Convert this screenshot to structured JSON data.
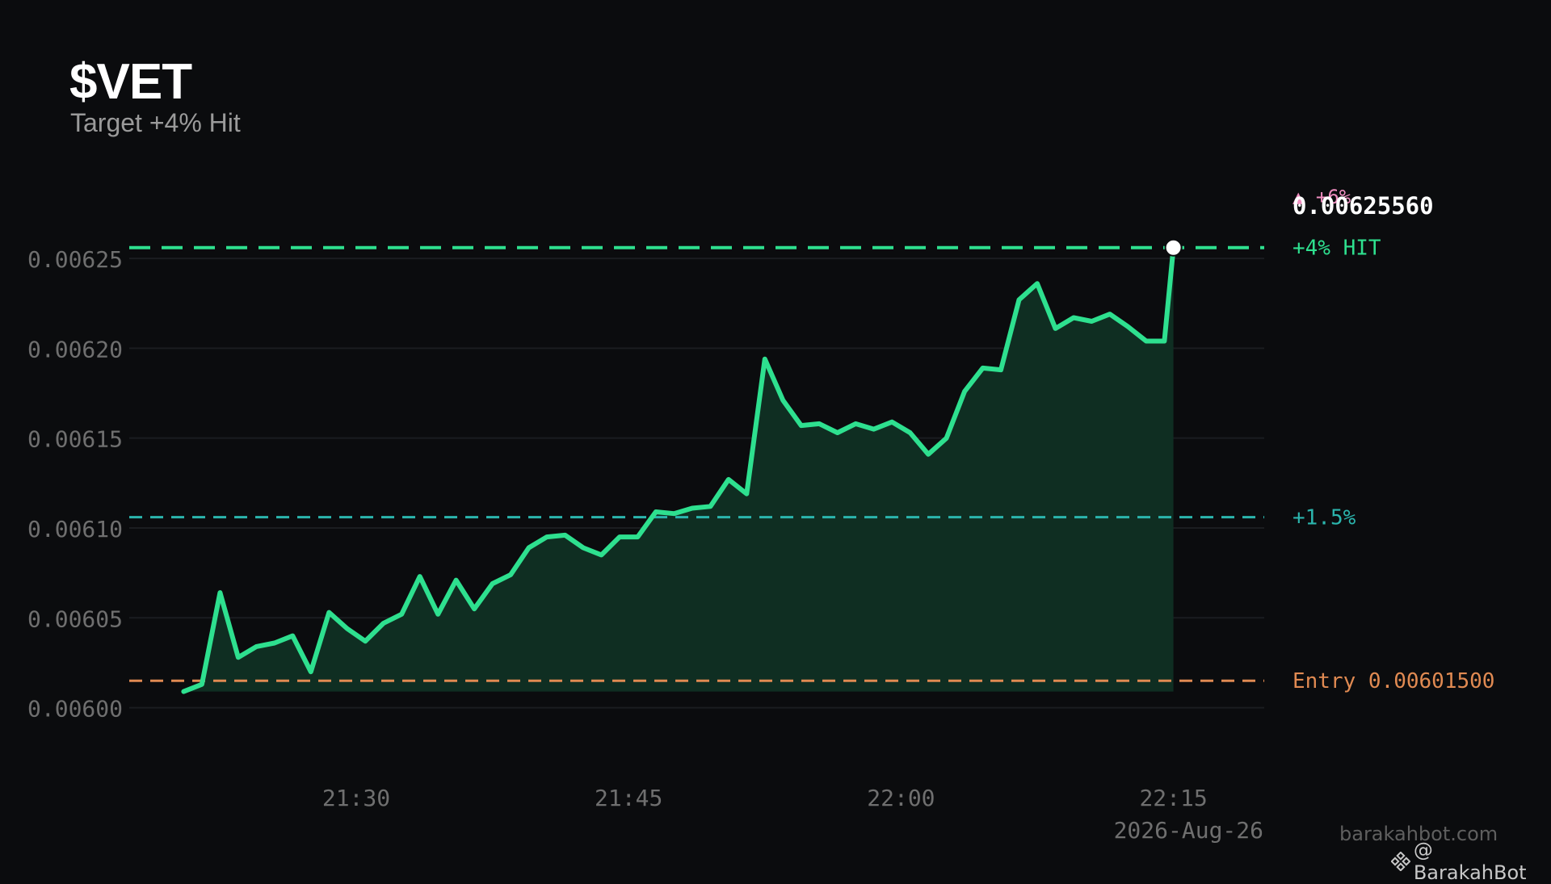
{
  "header": {
    "symbol": "$VET",
    "subtitle": "Target +4% Hit"
  },
  "footer": {
    "date": "2026-Aug-26",
    "site": "barakahbot.com",
    "handle": "@ BarakahBot"
  },
  "colors": {
    "background": "#0b0c0e",
    "price_line": "#2ee08f",
    "area_fill": "#0f2e22",
    "target_4": "#2ee08f",
    "target_1_5": "#2bb5ad",
    "entry": "#e08a52",
    "target_6": "#f08ec0",
    "axis_text": "#6f6f6f",
    "grid": "#1b1d20"
  },
  "chart_data": {
    "type": "line",
    "x_tick_labels": [
      "21:30",
      "21:45",
      "22:00",
      "22:15"
    ],
    "x_ticks_minutes": [
      30,
      45,
      60,
      75
    ],
    "xlim_minutes": [
      17.5,
      80
    ],
    "y_tick_labels": [
      "0.00625",
      "0.00620",
      "0.00615",
      "0.00610",
      "0.00605",
      "0.00600"
    ],
    "y_ticks": [
      0.00625,
      0.0062,
      0.00615,
      0.0061,
      0.00605,
      0.006
    ],
    "ylim": [
      0.005985,
      0.006268
    ],
    "grid": true,
    "series": [
      {
        "x_minutes": [
          20.5,
          21.5,
          22.5,
          23.5,
          24.5,
          25.5,
          26.5,
          27.5,
          28.5,
          29.5,
          30.5,
          31.5,
          32.5,
          33.5,
          34.5,
          35.5,
          36.5,
          37.5,
          38.5,
          39.5,
          40.5,
          41.5,
          42.5,
          43.5,
          44.5,
          45.5,
          46.5,
          47.5,
          48.5,
          49.5,
          50.5,
          51.5,
          52.5,
          53.5,
          54.5,
          55.5,
          56.5,
          57.5,
          58.5,
          59.5,
          60.5,
          61.5,
          62.5,
          63.5,
          64.5,
          65.5,
          66.5,
          67.5,
          68.5,
          69.5,
          70.5,
          71.5,
          72.5,
          73.5,
          74.5,
          75.0
        ],
        "values": [
          0.006009,
          0.006013,
          0.006064,
          0.006028,
          0.006034,
          0.006036,
          0.00604,
          0.00602,
          0.006053,
          0.006044,
          0.006037,
          0.006047,
          0.006052,
          0.006073,
          0.006052,
          0.006071,
          0.006055,
          0.006069,
          0.006074,
          0.006089,
          0.006095,
          0.006096,
          0.006089,
          0.006085,
          0.006095,
          0.006095,
          0.006109,
          0.006108,
          0.006111,
          0.006112,
          0.006127,
          0.006119,
          0.006194,
          0.006171,
          0.006157,
          0.006158,
          0.006153,
          0.006158,
          0.006155,
          0.006159,
          0.006153,
          0.006141,
          0.00615,
          0.006176,
          0.006189,
          0.006188,
          0.006227,
          0.006236,
          0.006211,
          0.006217,
          0.006215,
          0.006219,
          0.006212,
          0.006204,
          0.006204,
          0.006256
        ]
      }
    ],
    "last_price": 0.0062556,
    "annotations": [
      {
        "id": "target6",
        "label": "▲ +6%",
        "value": null
      },
      {
        "id": "last",
        "label": "0.00625560",
        "value": 0.0062556
      },
      {
        "id": "target4",
        "label": "+4%  HIT",
        "value": 0.006256
      },
      {
        "id": "target15",
        "label": "+1.5%",
        "value": 0.006106
      },
      {
        "id": "entry",
        "label": "Entry 0.00601500",
        "value": 0.006015
      }
    ]
  }
}
